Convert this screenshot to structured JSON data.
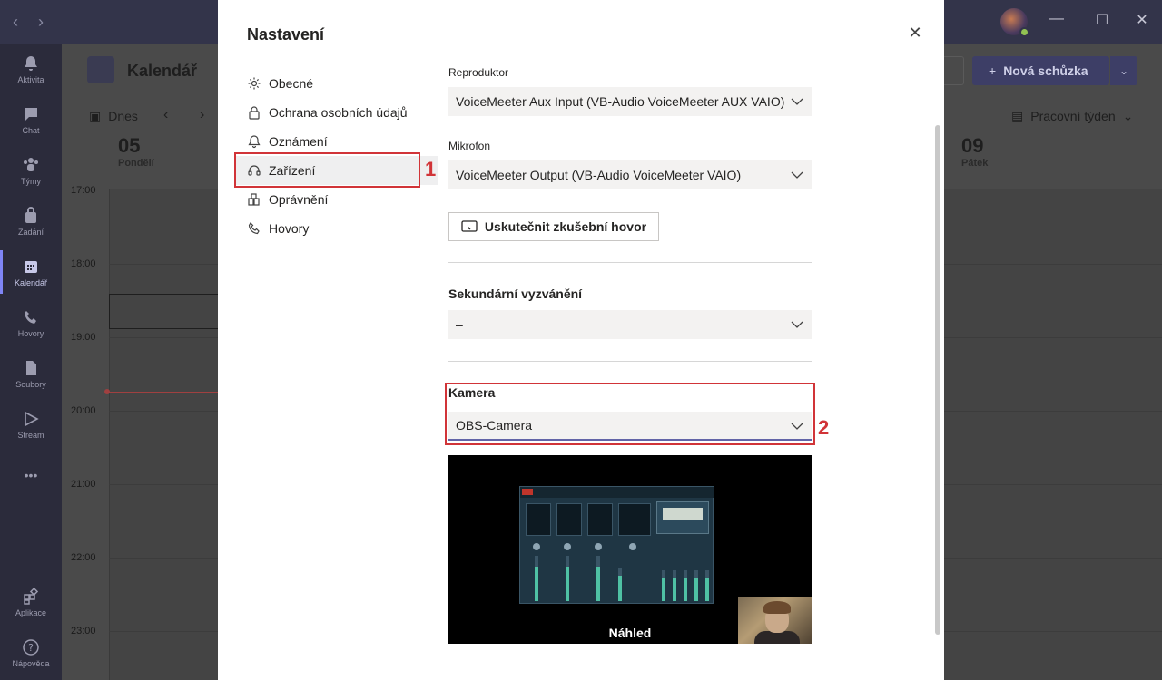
{
  "titlebar": {
    "back_icon": "‹",
    "forward_icon": "›",
    "min_icon": "—",
    "max_icon": "☐",
    "close_icon": "✕"
  },
  "rail": {
    "items": [
      {
        "label": "Aktivita",
        "icon": "bell-icon"
      },
      {
        "label": "Chat",
        "icon": "chat-icon"
      },
      {
        "label": "Týmy",
        "icon": "teams-icon"
      },
      {
        "label": "Zadání",
        "icon": "assignments-icon"
      },
      {
        "label": "Kalendář",
        "icon": "calendar-icon"
      },
      {
        "label": "Hovory",
        "icon": "phone-icon"
      },
      {
        "label": "Soubory",
        "icon": "files-icon"
      },
      {
        "label": "Stream",
        "icon": "stream-icon"
      },
      {
        "label": "•••",
        "icon": "more-icon"
      },
      {
        "label": "Aplikace",
        "icon": "apps-icon"
      },
      {
        "label": "Nápověda",
        "icon": "help-icon"
      }
    ]
  },
  "calendar": {
    "title": "Kalendář",
    "new_meeting": "Nová schůzka",
    "today": "Dnes",
    "view": "Pracovní týden",
    "day1_num": "05",
    "day1_name": "Pondělí",
    "day5_num": "09",
    "day5_name": "Pátek",
    "hours": [
      "17:00",
      "18:00",
      "19:00",
      "20:00",
      "21:00",
      "22:00",
      "23:00"
    ]
  },
  "dialog": {
    "title": "Nastavení",
    "nav": [
      {
        "label": "Obecné",
        "icon": "gear-icon"
      },
      {
        "label": "Ochrana osobních údajů",
        "icon": "lock-icon"
      },
      {
        "label": "Oznámení",
        "icon": "bell-icon"
      },
      {
        "label": "Zařízení",
        "icon": "headset-icon"
      },
      {
        "label": "Oprávnění",
        "icon": "permissions-icon"
      },
      {
        "label": "Hovory",
        "icon": "phone-icon"
      }
    ],
    "annotation_1": "1",
    "annotation_2": "2",
    "speaker_label": "Reproduktor",
    "speaker_value": "VoiceMeeter Aux Input (VB-Audio VoiceMeeter AUX VAIO)",
    "mic_label": "Mikrofon",
    "mic_value": "VoiceMeeter Output (VB-Audio VoiceMeeter VAIO)",
    "test_call": "Uskutečnit zkušební hovor",
    "secondary_ring_label": "Sekundární vyzvánění",
    "secondary_ring_value": "–",
    "camera_label": "Kamera",
    "camera_value": "OBS-Camera",
    "preview_label": "Náhled"
  },
  "colors": {
    "accent": "#6264a7",
    "annotation": "#d13438",
    "titlebar": "#33344a",
    "rail": "#2b2b3b"
  }
}
